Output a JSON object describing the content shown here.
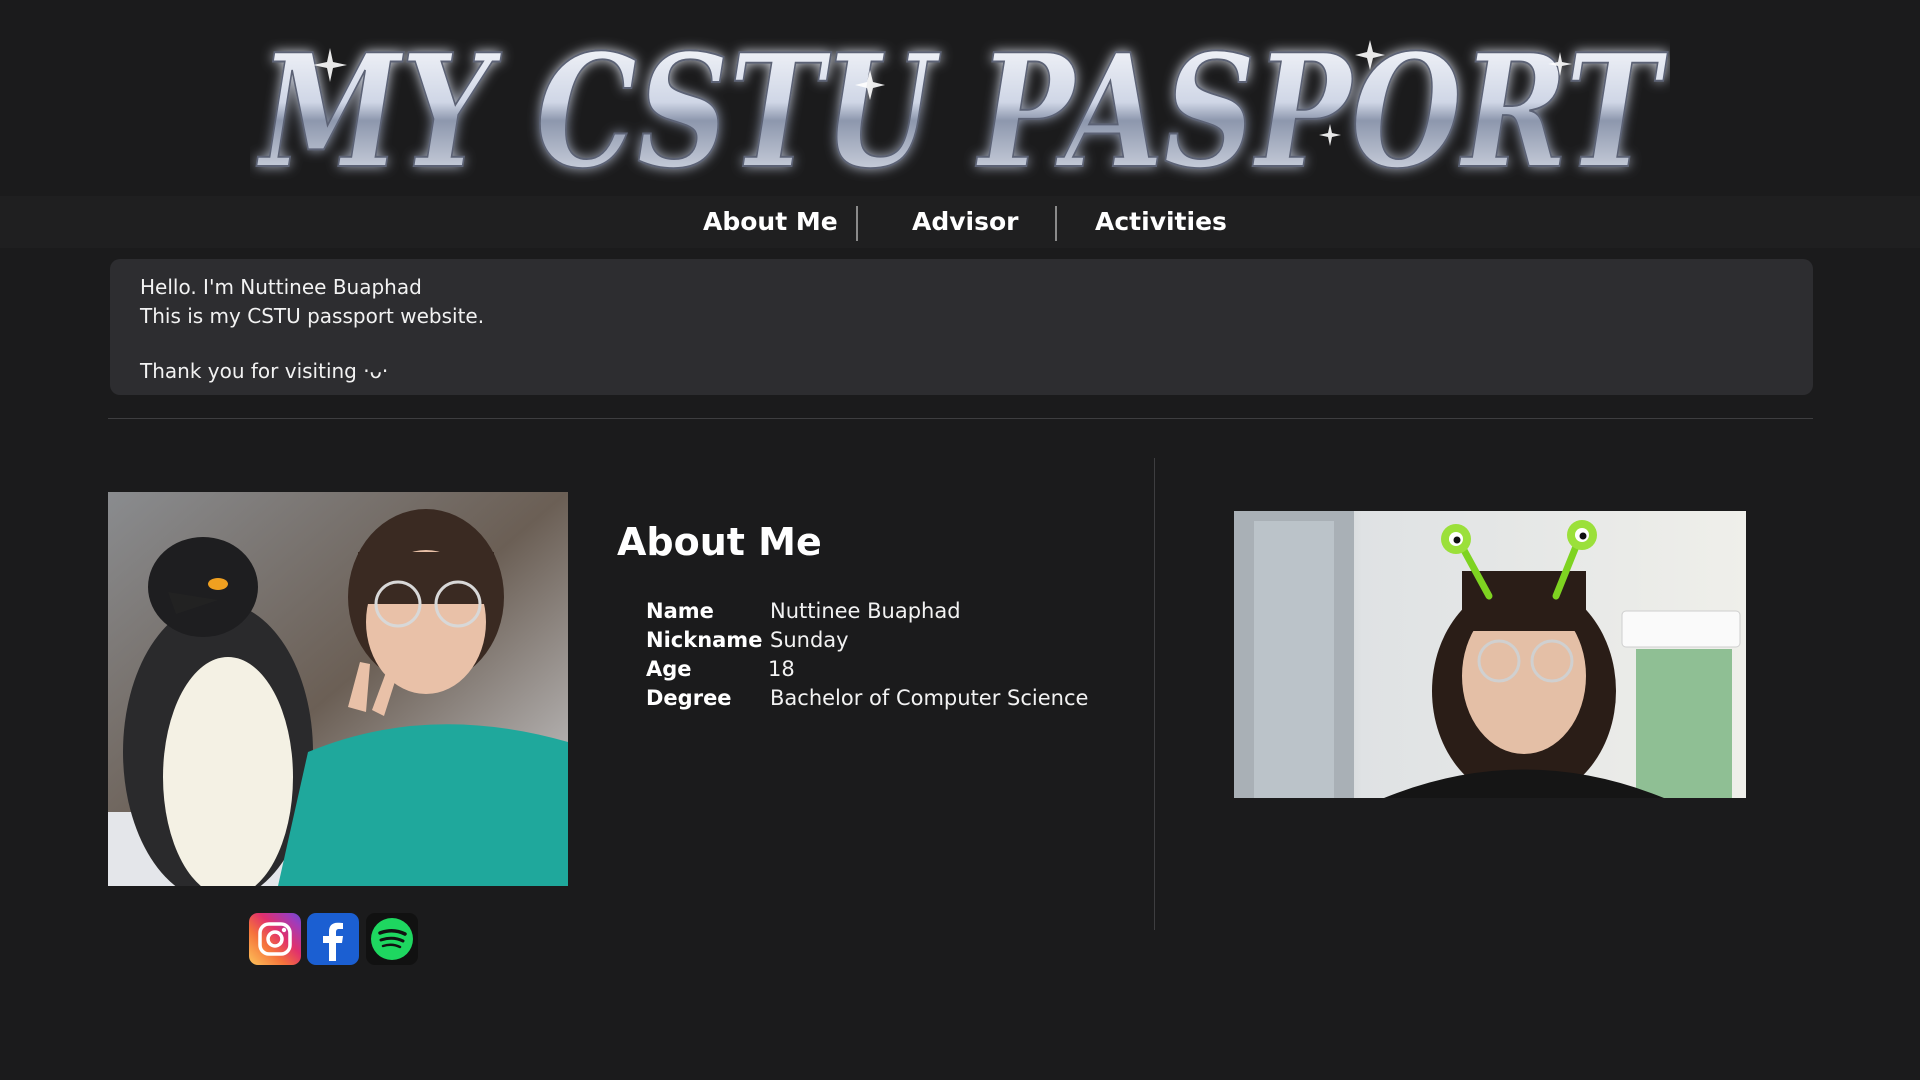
{
  "header": {
    "logo_text": "MY CSTU PASPORT"
  },
  "nav": {
    "items": [
      {
        "label": "About Me"
      },
      {
        "label": "Advisor"
      },
      {
        "label": "Activities"
      }
    ]
  },
  "intro": {
    "line1": "Hello. I'm Nuttinee Buaphad",
    "line2": "This is my CSTU passport website.",
    "line3": "Thank you for visiting ·ᴗ·"
  },
  "about": {
    "title": "About Me",
    "rows": [
      {
        "label": "Name",
        "value": "Nuttinee Buaphad"
      },
      {
        "label": "Nickname",
        "value": "Sunday"
      },
      {
        "label": "Age",
        "value": "18"
      },
      {
        "label": "Degree",
        "value": "Bachelor of Computer Science"
      }
    ]
  },
  "social": {
    "icons": [
      "instagram-icon",
      "facebook-icon",
      "spotify-icon"
    ]
  },
  "colors": {
    "background": "#1b1b1c",
    "nav_background": "#1f1f20",
    "intro_background": "#2d2d30",
    "text": "#ffffff"
  }
}
